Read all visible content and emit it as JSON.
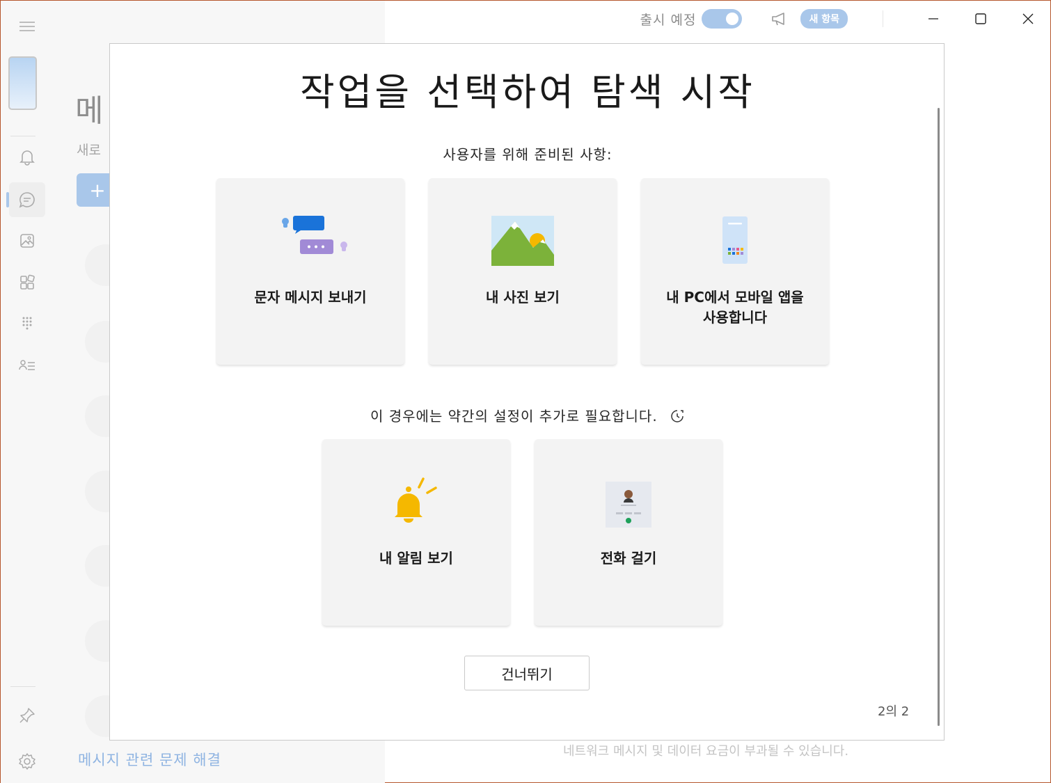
{
  "titlebar": {
    "coming_soon_label": "출시 예정",
    "new_items_badge": "새 항목"
  },
  "background": {
    "title": "메",
    "subtitle": "새로",
    "new_button": "+",
    "help_link": "메시지 관련 문제 해결",
    "disclaimer": "네트워크 메시지 및 데이터 요금이 부과될 수 있습니다."
  },
  "dialog": {
    "title": "작업을 선택하여 탐색 시작",
    "ready_label": "사용자를 위해 준비된 사항:",
    "setup_label": "이 경우에는 약간의 설정이 추가로 필요합니다.",
    "ready_cards": [
      {
        "label": "문자 메시지 보내기",
        "icon": "messages-icon"
      },
      {
        "label": "내 사진 보기",
        "icon": "photos-icon"
      },
      {
        "label": "내 PC에서 모바일 앱을 사용합니다",
        "icon": "phone-apps-icon"
      }
    ],
    "setup_cards": [
      {
        "label": "내 알림 보기",
        "icon": "bell-icon"
      },
      {
        "label": "전화 걸기",
        "icon": "contact-call-icon"
      }
    ],
    "skip_button": "건너뛰기",
    "pager": "2의 2"
  },
  "colors": {
    "accent_light": "#a9c7ea",
    "message_blue": "#1a73d9",
    "message_purple": "#a18ad6",
    "bell_yellow": "#f5b800",
    "photo_green": "#7cb23a"
  }
}
